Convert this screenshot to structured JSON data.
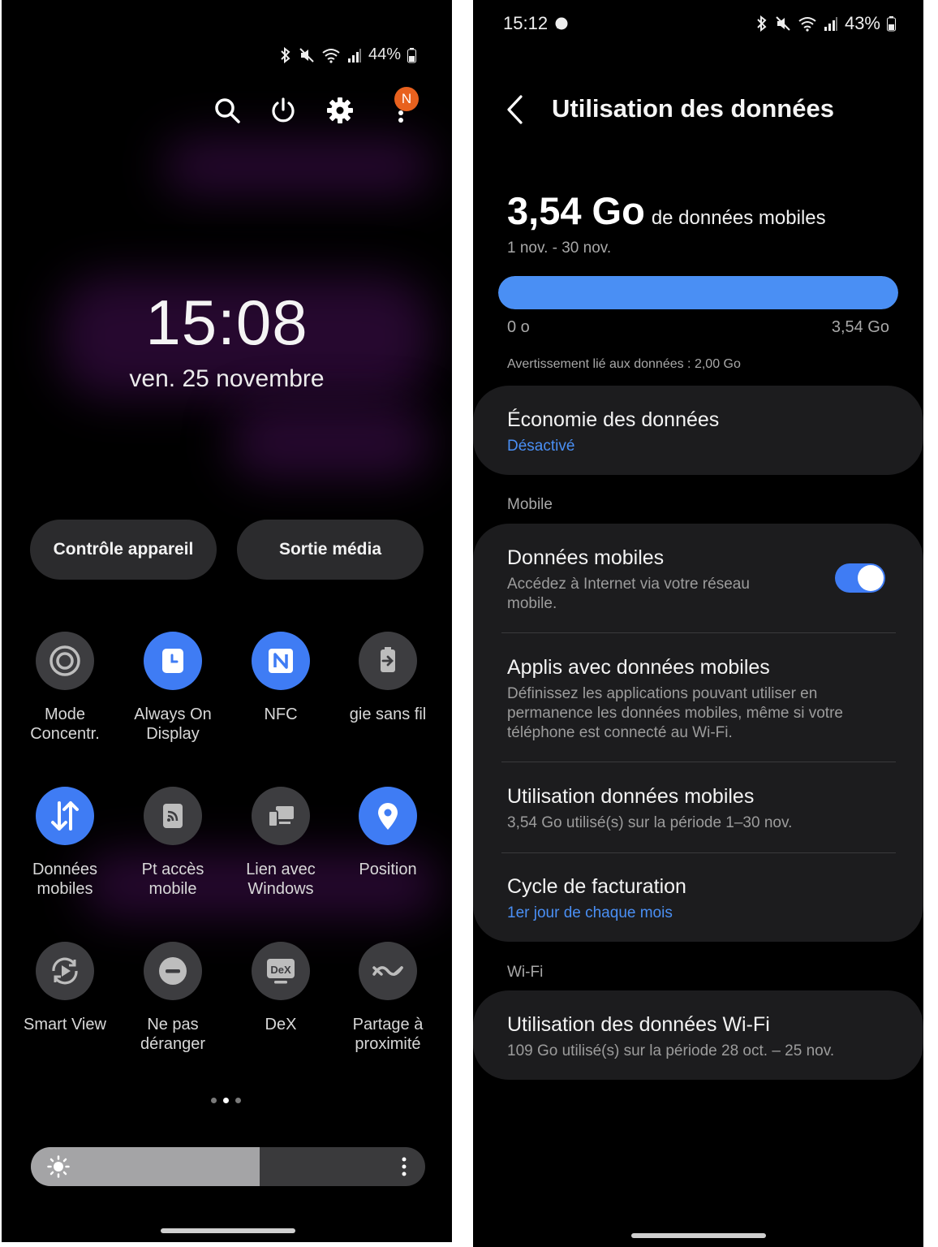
{
  "left": {
    "status": {
      "battery": "44%"
    },
    "notification_badge": "N",
    "clock": "15:08",
    "date": "ven. 25 novembre",
    "pills": {
      "device_control": "Contrôle appareil",
      "media_output": "Sortie média"
    },
    "tiles": [
      {
        "label": "Mode\nConcentr.",
        "icon": "focus-mode-icon",
        "active": false
      },
      {
        "label": "Always On\nDisplay",
        "icon": "clock-icon",
        "active": true
      },
      {
        "label": "NFC",
        "icon": "nfc-icon",
        "active": true
      },
      {
        "label": "gie sans fil",
        "icon": "wireless-powershare-icon",
        "active": false
      },
      {
        "label": "Données\nmobiles",
        "icon": "mobile-data-icon",
        "active": true
      },
      {
        "label": "Pt accès\nmobile",
        "icon": "hotspot-icon",
        "active": false
      },
      {
        "label": "Lien avec\nWindows",
        "icon": "link-to-windows-icon",
        "active": false
      },
      {
        "label": "Position",
        "icon": "location-icon",
        "active": true
      },
      {
        "label": "Smart View",
        "icon": "smart-view-icon",
        "active": false
      },
      {
        "label": "Ne pas\ndéranger",
        "icon": "do-not-disturb-icon",
        "active": false
      },
      {
        "label": "DeX",
        "icon": "dex-icon",
        "active": false
      },
      {
        "label": "Partage à\nproximité",
        "icon": "nearby-share-icon",
        "active": false
      }
    ],
    "brightness_level": 0.58,
    "dex_icon_text": "DeX"
  },
  "right": {
    "status": {
      "time": "15:12",
      "battery": "43%"
    },
    "title": "Utilisation des données",
    "usage": {
      "amount": "3,54 Go",
      "suffix": "de données mobiles",
      "period": "1 nov. - 30 nov.",
      "fraction": 1.0,
      "min_label": "0 o",
      "max_label": "3,54 Go",
      "warning": "Avertissement lié aux données : 2,00 Go"
    },
    "data_saver": {
      "title": "Économie des données",
      "status": "Désactivé"
    },
    "section_mobile": "Mobile",
    "mobile_data": {
      "title": "Données mobiles",
      "subtitle": "Accédez à Internet via votre réseau mobile.",
      "enabled": true
    },
    "apps_mobile_data": {
      "title": "Applis avec données mobiles",
      "subtitle": "Définissez les applications pouvant utiliser en permanence les données mobiles, même si votre téléphone est connecté au Wi-Fi."
    },
    "mobile_usage": {
      "title": "Utilisation données mobiles",
      "subtitle": "3,54 Go utilisé(s) sur la période 1–30 nov."
    },
    "billing_cycle": {
      "title": "Cycle de facturation",
      "subtitle": "1er jour de chaque mois"
    },
    "section_wifi": "Wi-Fi",
    "wifi_usage": {
      "title": "Utilisation des données Wi-Fi",
      "subtitle": "109 Go utilisé(s) sur la période 28 oct. – 25 nov."
    }
  },
  "colors": {
    "accent": "#3f7cf4",
    "link_blue": "#4a8ff4",
    "badge": "#e8611e",
    "card": "#1c1c1e",
    "tile_off": "#3d3d40"
  }
}
